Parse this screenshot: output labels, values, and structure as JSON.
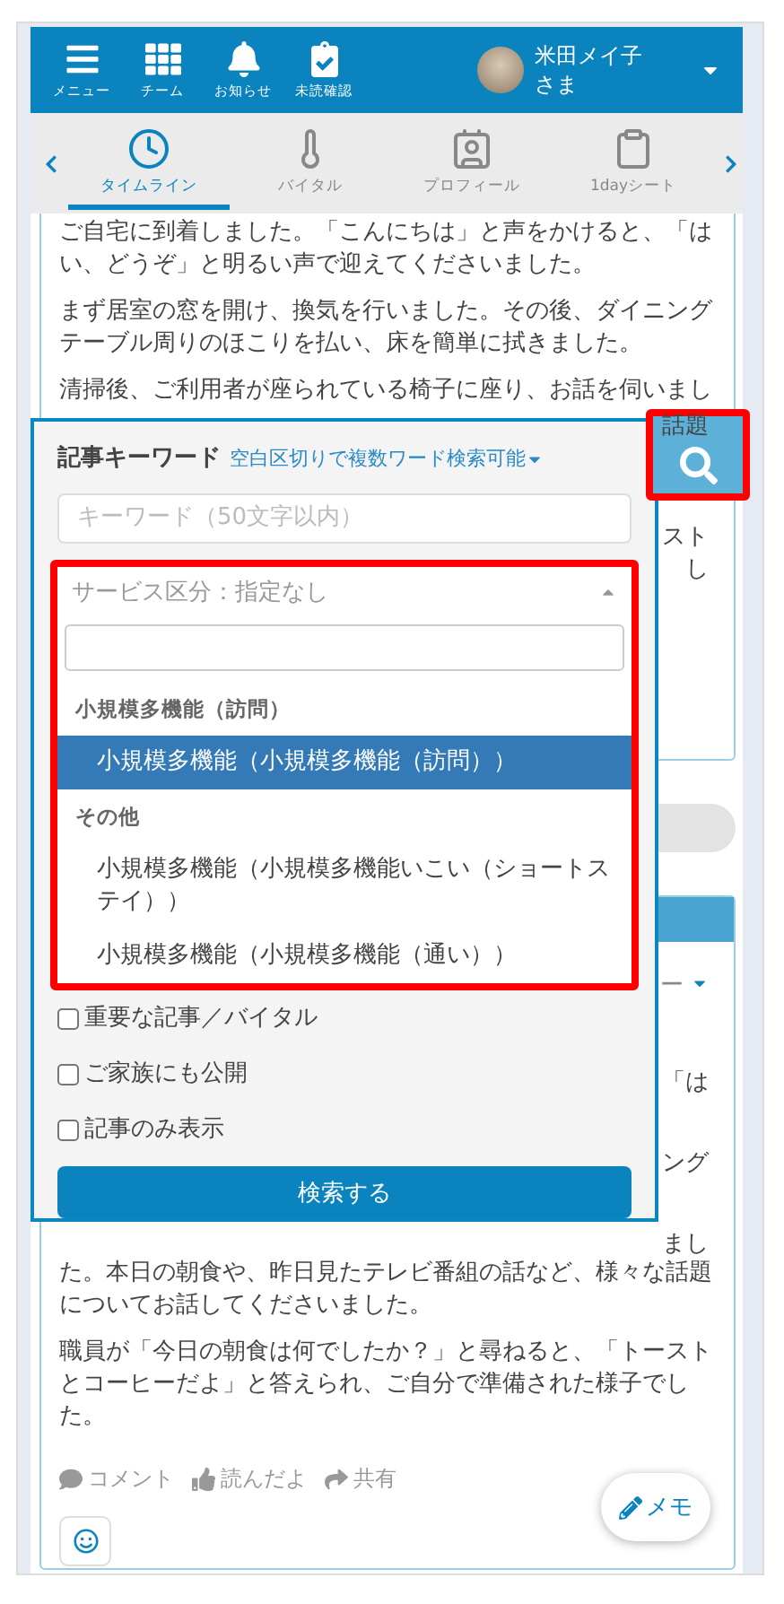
{
  "header": {
    "nav": [
      {
        "label": "メニュー",
        "kind": "menu"
      },
      {
        "label": "チーム",
        "kind": "grid"
      },
      {
        "label": "お知らせ",
        "kind": "bell"
      },
      {
        "label": "未読確認",
        "kind": "checklist"
      }
    ],
    "user": {
      "name": "米田メイ子",
      "suffix": "さま"
    }
  },
  "tabs": [
    {
      "label": "タイムライン",
      "kind": "clock",
      "selected": true
    },
    {
      "label": "バイタル",
      "kind": "thermometer",
      "selected": false
    },
    {
      "label": "プロフィール",
      "kind": "card",
      "selected": false
    },
    {
      "label": "1dayシート",
      "kind": "clipboard",
      "selected": false
    }
  ],
  "timeline": {
    "top_paragraphs": [
      "ご自宅に到着しました。「こんにちは」と声をかけると、「はい、どうぞ」と明るい声で迎えてくださいました。",
      "まず居室の窓を開け、換気を行いました。その後、ダイニングテーブル周りのほこりを払い、床を簡単に拭きました。",
      "清掃後、ご利用者が座られている椅子に座り、お話を伺いまし"
    ],
    "card1_fragments": [
      "話題",
      "スト",
      "し"
    ],
    "card2_fragments": [
      "ー",
      "「は",
      "ング",
      "まし"
    ],
    "bottom_paragraphs": [
      "た。本日の朝食や、昨日見たテレビ番組の話など、様々な話題についてお話してくださいました。",
      "職員が「今日の朝食は何でしたか？」と尋ねると、「トーストとコーヒーだよ」と答えられ、ご自分で準備された様子でした。"
    ],
    "actions": [
      {
        "label": "コメント",
        "kind": "comment"
      },
      {
        "label": "読んだよ",
        "kind": "like"
      },
      {
        "label": "共有",
        "kind": "share"
      }
    ]
  },
  "memo_button": "メモ",
  "search_panel": {
    "title": "記事キーワード",
    "hint": "空白区切りで複数ワード検索可能",
    "keyword": {
      "placeholder": "キーワード（50文字以内）"
    },
    "service_select": {
      "placeholder": "サービス区分：指定なし",
      "expanded": true,
      "groups": [
        {
          "label": "小規模多機能（訪問）",
          "options": [
            {
              "label": "小規模多機能（小規模多機能（訪問））",
              "selected": true
            }
          ]
        },
        {
          "label": "その他",
          "options": [
            {
              "label": "小規模多機能（小規模多機能いこい（ショートステイ））",
              "selected": false
            },
            {
              "label": "小規模多機能（小規模多機能（通い））",
              "selected": false
            }
          ]
        }
      ]
    },
    "checkboxes": [
      {
        "label": "重要な記事／バイタル",
        "checked": false
      },
      {
        "label": "ご家族にも公開",
        "checked": false
      },
      {
        "label": "記事のみ表示",
        "checked": false
      }
    ],
    "submit": "検索する"
  }
}
